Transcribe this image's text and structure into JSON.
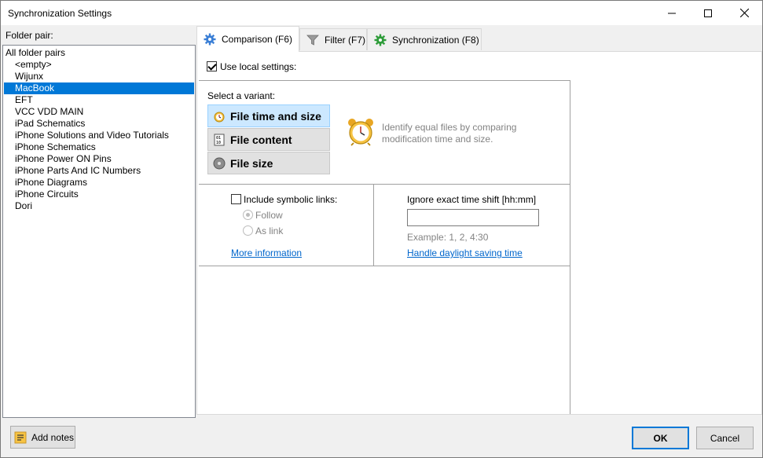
{
  "window": {
    "title": "Synchronization Settings"
  },
  "folder_pairs": {
    "label": "Folder pair:",
    "items": [
      {
        "label": "All folder pairs",
        "indent": false,
        "selected": false
      },
      {
        "label": "<empty>",
        "indent": true,
        "selected": false
      },
      {
        "label": "Wijunx",
        "indent": true,
        "selected": false
      },
      {
        "label": "MacBook",
        "indent": true,
        "selected": true
      },
      {
        "label": "EFT",
        "indent": true,
        "selected": false
      },
      {
        "label": "VCC VDD MAIN",
        "indent": true,
        "selected": false
      },
      {
        "label": "iPad Schematics",
        "indent": true,
        "selected": false
      },
      {
        "label": "iPhone Solutions and Video Tutorials",
        "indent": true,
        "selected": false
      },
      {
        "label": "iPhone Schematics",
        "indent": true,
        "selected": false
      },
      {
        "label": "iPhone Power ON Pins",
        "indent": true,
        "selected": false
      },
      {
        "label": "iPhone Parts And IC Numbers",
        "indent": true,
        "selected": false
      },
      {
        "label": "iPhone Diagrams",
        "indent": true,
        "selected": false
      },
      {
        "label": "iPhone Circuits",
        "indent": true,
        "selected": false
      },
      {
        "label": "Dori",
        "indent": true,
        "selected": false
      }
    ]
  },
  "tabs": [
    {
      "label": "Comparison (F6)",
      "icon": "gear-icon",
      "active": true
    },
    {
      "label": "Filter (F7)",
      "icon": "filter-icon",
      "active": false
    },
    {
      "label": "Synchronization (F8)",
      "icon": "sync-gear-icon",
      "active": false
    }
  ],
  "comparison": {
    "use_local_settings": {
      "label": "Use local settings:",
      "checked": true
    },
    "variant_label": "Select a variant:",
    "variants": [
      {
        "label": "File time and size",
        "icon": "clock-icon",
        "selected": true
      },
      {
        "label": "File content",
        "icon": "binary-file-icon",
        "selected": false
      },
      {
        "label": "File size",
        "icon": "disk-icon",
        "selected": false
      }
    ],
    "description": [
      "Identify equal files by comparing",
      "modification time and size."
    ],
    "symlinks": {
      "label": "Include symbolic links:",
      "checked": false,
      "options": [
        {
          "label": "Follow",
          "selected": true
        },
        {
          "label": "As link",
          "selected": false
        }
      ],
      "more_info": "More information"
    },
    "time_shift": {
      "label": "Ignore exact time shift [hh:mm]",
      "value": "",
      "example": "Example:  1, 2, 4:30",
      "daylight_link": "Handle daylight saving time"
    }
  },
  "footer": {
    "add_notes": "Add notes",
    "ok": "OK",
    "cancel": "Cancel"
  },
  "colors": {
    "selection": "#0078d7",
    "link": "#0066cc",
    "selected_variant": "#cce8ff"
  }
}
